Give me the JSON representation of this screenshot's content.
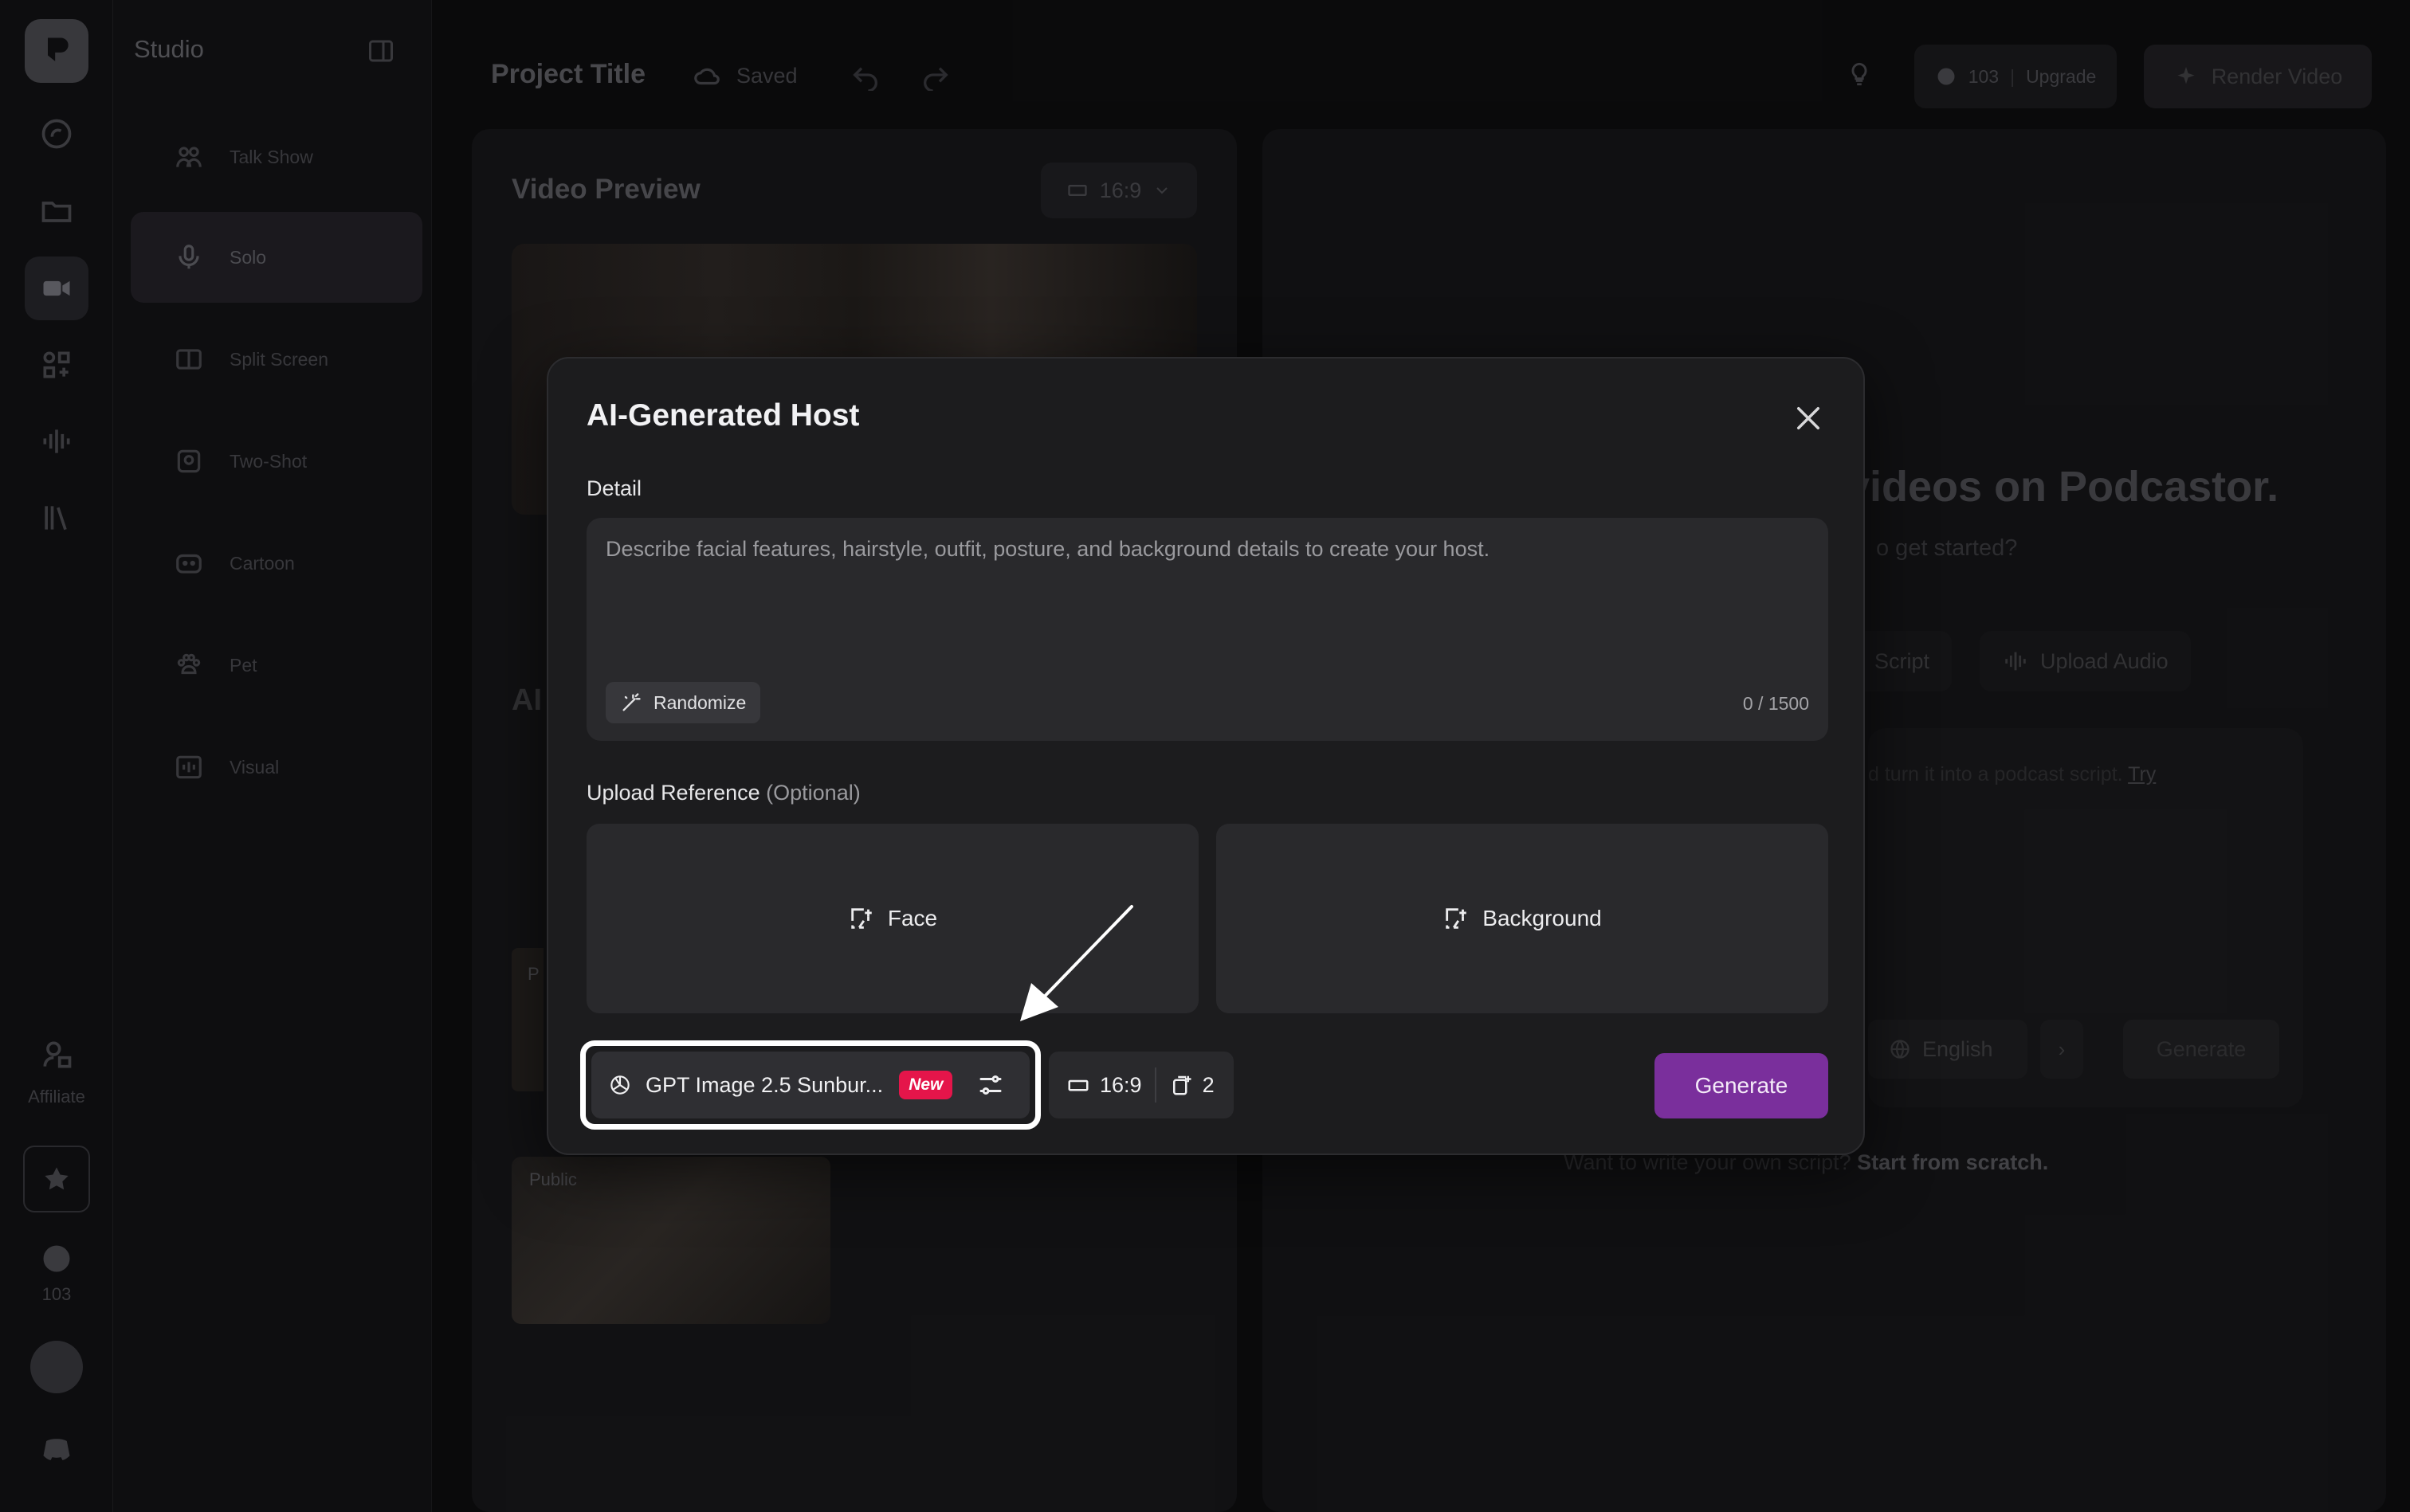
{
  "rail": {
    "affiliate_label": "Affiliate",
    "credits": "103"
  },
  "sidebar": {
    "title": "Studio",
    "items": [
      {
        "label": "Talk Show"
      },
      {
        "label": "Solo"
      },
      {
        "label": "Split Screen"
      },
      {
        "label": "Two-Shot"
      },
      {
        "label": "Cartoon"
      },
      {
        "label": "Pet"
      },
      {
        "label": "Visual"
      }
    ]
  },
  "topbar": {
    "project_title": "Project Title",
    "saved": "Saved",
    "credits": "103",
    "upgrade": "Upgrade",
    "render": "Render Video"
  },
  "left_panel": {
    "title": "Video Preview",
    "ratio": "16:9",
    "section_letter": "AI",
    "thumb_letter": "P",
    "public_label": "Public"
  },
  "right_panel": {
    "heading": "videos on Podcastor.",
    "sub": "o get started?",
    "chip_script": "Script",
    "chip_upload": "Upload Audio",
    "box_text": "d turn it into a podcast script.",
    "box_link": "Try",
    "language": "English",
    "generate": "Generate",
    "footer_text": "Want to write your own script?",
    "footer_link": "Start from scratch."
  },
  "modal": {
    "title": "AI-Generated Host",
    "detail_label": "Detail",
    "detail_value": "",
    "detail_placeholder": "Describe facial features, hairstyle, outfit, posture, and background details to create your host.",
    "randomize": "Randomize",
    "char_count": "0 / 1500",
    "upload_label": "Upload Reference",
    "upload_optional": "(Optional)",
    "face": "Face",
    "background": "Background",
    "model": "GPT Image 2.5 Sunbur...",
    "model_badge": "New",
    "ratio": "16:9",
    "count": "2",
    "generate": "Generate"
  },
  "colors": {
    "accent": "#7a2f9c",
    "badge": "#e5154a",
    "modal_bg": "#1c1c1e",
    "field_bg": "#29292c"
  }
}
